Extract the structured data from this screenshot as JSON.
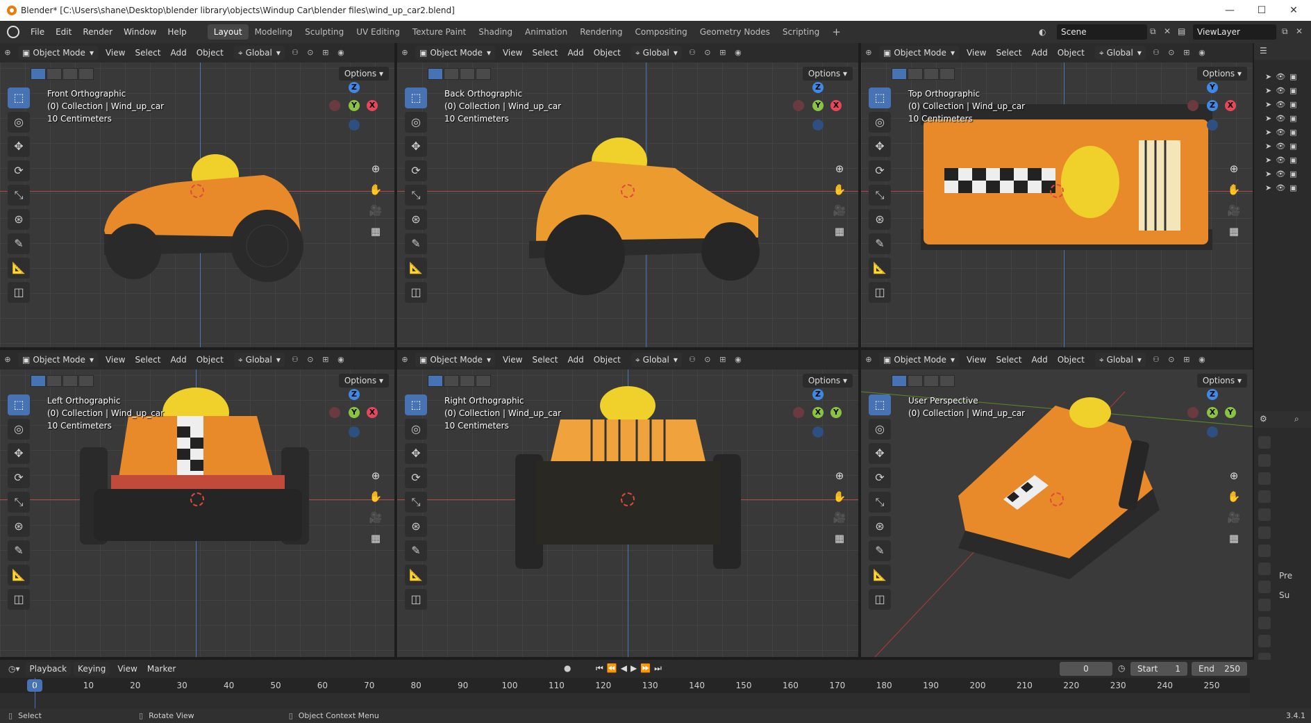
{
  "window": {
    "title": "Blender* [C:\\Users\\shane\\Desktop\\blender library\\objects\\Windup Car\\blender files\\wind_up_car2.blend]",
    "minimize": "—",
    "maximize": "☐",
    "close": "✕"
  },
  "menus": [
    "File",
    "Edit",
    "Render",
    "Window",
    "Help"
  ],
  "workspaces": [
    "Layout",
    "Modeling",
    "Sculpting",
    "UV Editing",
    "Texture Paint",
    "Shading",
    "Animation",
    "Rendering",
    "Compositing",
    "Geometry Nodes",
    "Scripting"
  ],
  "active_workspace": "Layout",
  "add_workspace": "+",
  "scene": "Scene",
  "view_layer": "ViewLayer",
  "viewport_header": {
    "mode": "Object Mode",
    "menus": [
      "View",
      "Select",
      "Add",
      "Object"
    ],
    "orientation": "Global",
    "options": "Options"
  },
  "viewports": [
    {
      "view": "Front Orthographic",
      "collection": "(0) Collection | Wind_up_car",
      "scale": "10 Centimeters",
      "gizmo": [
        "Z",
        "Y",
        "X"
      ]
    },
    {
      "view": "Back Orthographic",
      "collection": "(0) Collection | Wind_up_car",
      "scale": "10 Centimeters",
      "gizmo": [
        "Z",
        "Y",
        "X"
      ]
    },
    {
      "view": "Top Orthographic",
      "collection": "(0) Collection | Wind_up_car",
      "scale": "10 Centimeters",
      "gizmo": [
        "Y",
        "Z",
        "X"
      ]
    },
    {
      "view": "Left Orthographic",
      "collection": "(0) Collection | Wind_up_car",
      "scale": "10 Centimeters",
      "gizmo": [
        "Z",
        "Y",
        "X"
      ]
    },
    {
      "view": "Right Orthographic",
      "collection": "(0) Collection | Wind_up_car",
      "scale": "10 Centimeters",
      "gizmo": [
        "Z",
        "X",
        "Y"
      ]
    },
    {
      "view": "User Perspective",
      "collection": "(0) Collection | Wind_up_car",
      "scale": "",
      "gizmo": [
        "Z",
        "X",
        "Y"
      ]
    }
  ],
  "timeline": {
    "menus": [
      "Playback",
      "Keying",
      "View",
      "Marker"
    ],
    "current_frame": "0",
    "start_label": "Start",
    "start": "1",
    "end_label": "End",
    "end": "250",
    "ruler": [
      "0",
      "10",
      "20",
      "30",
      "40",
      "50",
      "60",
      "70",
      "80",
      "90",
      "100",
      "110",
      "120",
      "130",
      "140",
      "150",
      "160",
      "170",
      "180",
      "190",
      "200",
      "210",
      "220",
      "230",
      "240",
      "250"
    ]
  },
  "properties_labels": [
    "Pre",
    "Su"
  ],
  "status": {
    "select": "Select",
    "rotate": "Rotate View",
    "context": "Object Context Menu",
    "version": "3.4.1"
  },
  "colors": {
    "accent": "#4772b3",
    "x_axis": "#e8475a",
    "y_axis": "#8ac33f",
    "z_axis": "#3d8ae6",
    "car_orange": "#e8892a"
  }
}
